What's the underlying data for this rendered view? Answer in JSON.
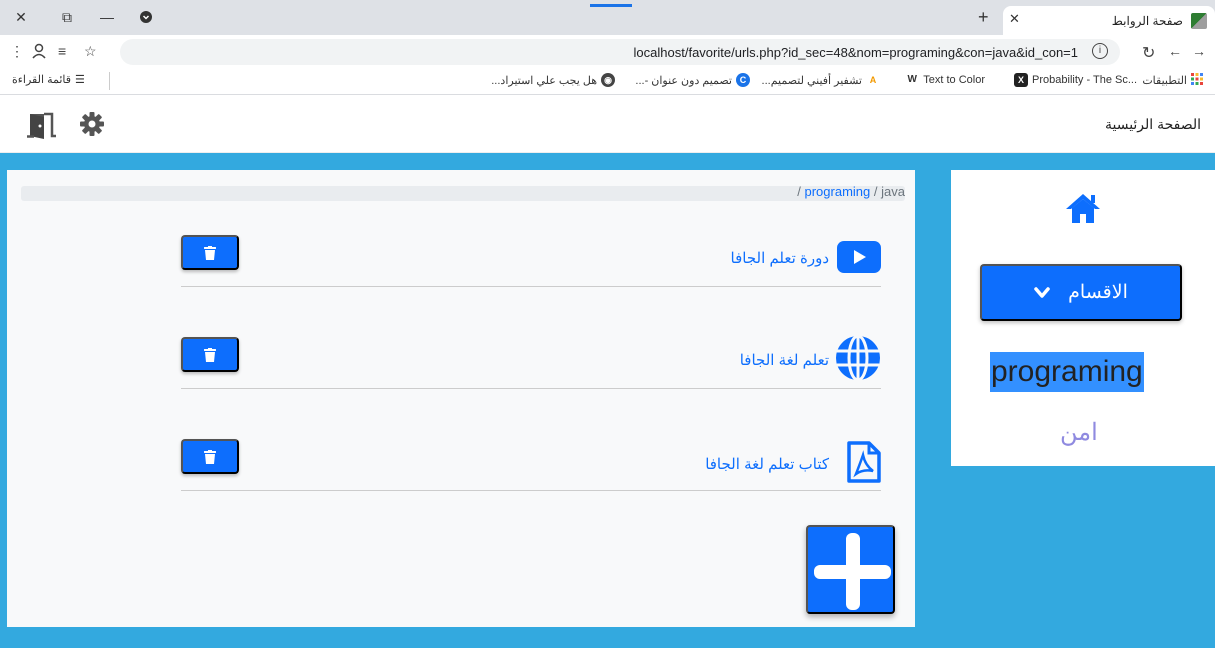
{
  "browser": {
    "tab_title": "صفحة الروابط",
    "url": "localhost/favorite/urls.php?id_sec=48&nom=programing&con=java&id_con=1",
    "bookmarks": [
      {
        "label": "التطبيقات",
        "icon": "apps-grid-icon",
        "color": "#e8453c"
      },
      {
        "label": "Probability - The Sc...",
        "icon": "bookmark-x-icon",
        "color": "#333333"
      },
      {
        "label": "Text to Color",
        "icon": "bookmark-w-icon",
        "color": "#333333"
      },
      {
        "label": "تشفير أفيني لتصميم...",
        "icon": "bookmark-a-icon",
        "color": "#f29900"
      },
      {
        "label": "تصميم دون عنوان -...",
        "icon": "bookmark-c-icon",
        "color": "#1a73e8"
      },
      {
        "label": "هل يجب علي استيراد...",
        "icon": "bookmark-globe-icon",
        "color": "#444444"
      }
    ],
    "reading_list": "قائمة القراءة"
  },
  "nav": {
    "home_link": "الصفحة الرئيسية",
    "settings_icon": "gear-icon",
    "logout_icon": "door-exit-icon"
  },
  "breadcrumb": {
    "items": [
      "programing",
      "java"
    ],
    "separator": "/"
  },
  "links": [
    {
      "label": "دورة تعلم الجافا",
      "icon": "youtube-icon"
    },
    {
      "label": "تعلم لغة الجافا",
      "icon": "globe-icon"
    },
    {
      "label": "كتاب تعلم لغة الجافا",
      "icon": "pdf-file-icon"
    }
  ],
  "sidebar": {
    "categories_label": "الاقسام",
    "section_name": "programing",
    "secure_label": "امن"
  },
  "colors": {
    "primary": "#0d6efd",
    "page_bg": "#33a9df"
  }
}
